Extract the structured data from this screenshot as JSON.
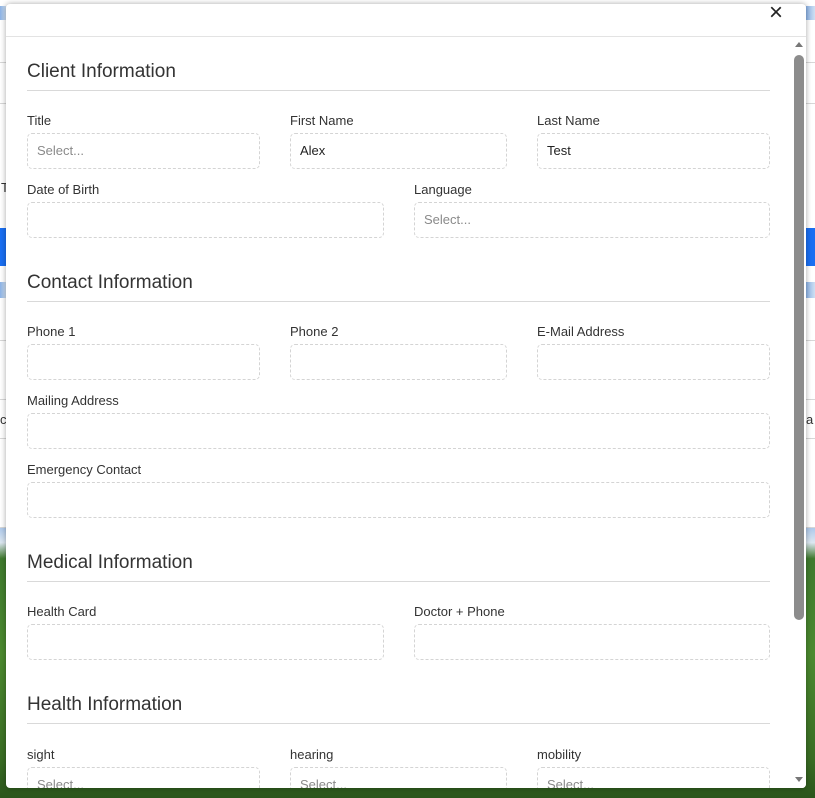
{
  "modal": {
    "close_label": "×"
  },
  "sections": {
    "client": {
      "title": "Client Information",
      "title_field": {
        "label": "Title",
        "placeholder": "Select..."
      },
      "first_name": {
        "label": "First Name",
        "value": "Alex"
      },
      "last_name": {
        "label": "Last Name",
        "value": "Test"
      },
      "dob": {
        "label": "Date of Birth",
        "value": ""
      },
      "language": {
        "label": "Language",
        "placeholder": "Select..."
      }
    },
    "contact": {
      "title": "Contact Information",
      "phone1": {
        "label": "Phone 1",
        "value": ""
      },
      "phone2": {
        "label": "Phone 2",
        "value": ""
      },
      "email": {
        "label": "E-Mail Address",
        "value": ""
      },
      "mailing": {
        "label": "Mailing Address",
        "value": ""
      },
      "emergency": {
        "label": "Emergency Contact",
        "value": ""
      }
    },
    "medical": {
      "title": "Medical Information",
      "health_card": {
        "label": "Health Card",
        "value": ""
      },
      "doctor": {
        "label": "Doctor + Phone",
        "value": ""
      }
    },
    "health": {
      "title": "Health Information",
      "sight": {
        "label": "sight",
        "placeholder": "Select..."
      },
      "hearing": {
        "label": "hearing",
        "placeholder": "Select..."
      },
      "mobility": {
        "label": "mobility",
        "placeholder": "Select..."
      }
    }
  },
  "background": {
    "left_char": "T",
    "left_char2": "c",
    "right_char": "a"
  }
}
